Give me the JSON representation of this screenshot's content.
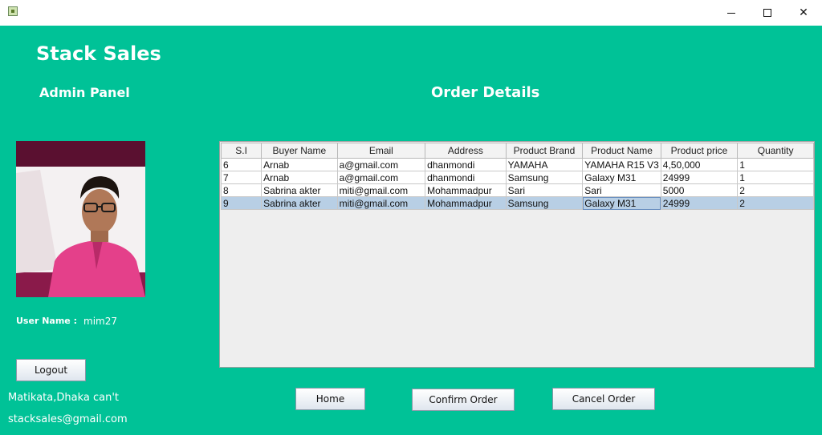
{
  "window": {
    "minimize_glyph": "",
    "maximize_glyph": "",
    "close_glyph": "✕"
  },
  "sidebar": {
    "brand": "Stack Sales",
    "panel_title": "Admin Panel",
    "user_label": "User Name :",
    "user_value": "mim27",
    "logout_label": "Logout",
    "address": "Matikata,Dhaka can't",
    "email": "stacksales@gmail.com"
  },
  "main": {
    "title": "Order Details",
    "table": {
      "columns": [
        "S.I",
        "Buyer  Name",
        "Email",
        "Address",
        "Product Brand",
        "Product Name",
        "Product price",
        "Quantity"
      ],
      "rows": [
        [
          "6",
          "Arnab",
          "a@gmail.com",
          "dhanmondi",
          "YAMAHA",
          "YAMAHA R15 V3",
          "4,50,000",
          "1"
        ],
        [
          "7",
          "Arnab",
          "a@gmail.com",
          "dhanmondi",
          "Samsung",
          "Galaxy M31",
          "24999",
          "1"
        ],
        [
          "8",
          "Sabrina akter",
          "miti@gmail.com",
          "Mohammadpur",
          "Sari",
          "Sari",
          "5000",
          "2"
        ],
        [
          "9",
          "Sabrina akter",
          "miti@gmail.com",
          "Mohammadpur",
          "Samsung",
          "Galaxy M31",
          "24999",
          "2"
        ]
      ],
      "selected_row": 3
    },
    "buttons": {
      "home": "Home",
      "confirm": "Confirm Order",
      "cancel": "Cancel Order"
    }
  },
  "colors": {
    "background": "#00c297",
    "selection": "#b8cfe5"
  }
}
